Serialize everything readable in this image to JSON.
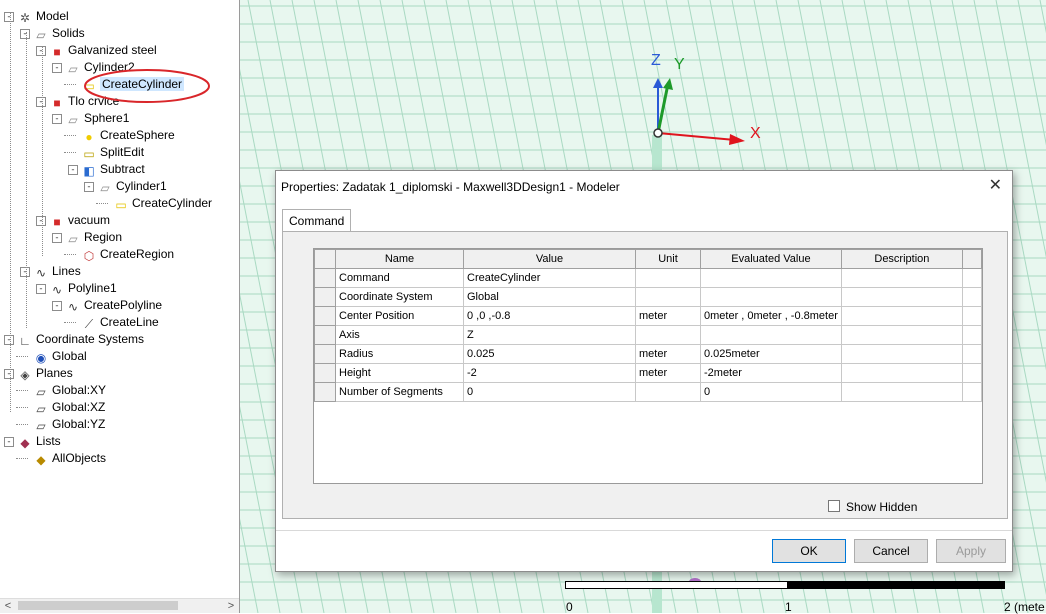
{
  "tree": {
    "nodes": [
      {
        "label": "Model",
        "icon": "model-icon",
        "level": 0,
        "expand": "-"
      },
      {
        "label": "Solids",
        "icon": "solids-folder-icon",
        "level": 1,
        "expand": "-"
      },
      {
        "label": "Galvanized steel",
        "icon": "material-icon",
        "level": 2,
        "expand": "-"
      },
      {
        "label": "Cylinder2",
        "icon": "solid-object-icon",
        "level": 3,
        "expand": "-"
      },
      {
        "label": "CreateCylinder",
        "icon": "cylinder-icon",
        "level": 4,
        "expand": "",
        "selected": true
      },
      {
        "label": "Tlo crvice",
        "icon": "material-icon",
        "level": 2,
        "expand": "-"
      },
      {
        "label": "Sphere1",
        "icon": "solid-object-icon",
        "level": 3,
        "expand": "-"
      },
      {
        "label": "CreateSphere",
        "icon": "sphere-icon",
        "level": 4,
        "expand": ""
      },
      {
        "label": "SplitEdit",
        "icon": "split-icon",
        "level": 4,
        "expand": ""
      },
      {
        "label": "Subtract",
        "icon": "subtract-icon",
        "level": 4,
        "expand": "-"
      },
      {
        "label": "Cylinder1",
        "icon": "solid-object-icon",
        "level": 5,
        "expand": "-"
      },
      {
        "label": "CreateCylinder",
        "icon": "cylinder-icon",
        "level": 6,
        "expand": ""
      },
      {
        "label": "vacuum",
        "icon": "material-icon",
        "level": 2,
        "expand": "-"
      },
      {
        "label": "Region",
        "icon": "solid-object-icon",
        "level": 3,
        "expand": "-"
      },
      {
        "label": "CreateRegion",
        "icon": "region-icon",
        "level": 4,
        "expand": ""
      },
      {
        "label": "Lines",
        "icon": "lines-icon",
        "level": 1,
        "expand": "-"
      },
      {
        "label": "Polyline1",
        "icon": "lines-icon",
        "level": 2,
        "expand": "-"
      },
      {
        "label": "CreatePolyline",
        "icon": "lines-icon",
        "level": 3,
        "expand": "-"
      },
      {
        "label": "CreateLine",
        "icon": "line-segment-icon",
        "level": 4,
        "expand": ""
      },
      {
        "label": "Coordinate Systems",
        "icon": "coordinate-system-icon",
        "level": 0,
        "expand": "-"
      },
      {
        "label": "Global",
        "icon": "global-cs-icon",
        "level": 1,
        "expand": ""
      },
      {
        "label": "Planes",
        "icon": "planes-icon",
        "level": 0,
        "expand": "-"
      },
      {
        "label": "Global:XY",
        "icon": "plane-icon",
        "level": 1,
        "expand": ""
      },
      {
        "label": "Global:XZ",
        "icon": "plane-icon",
        "level": 1,
        "expand": ""
      },
      {
        "label": "Global:YZ",
        "icon": "plane-icon",
        "level": 1,
        "expand": ""
      },
      {
        "label": "Lists",
        "icon": "lists-icon",
        "level": 0,
        "expand": "-"
      },
      {
        "label": "AllObjects",
        "icon": "all-objects-icon",
        "level": 1,
        "expand": ""
      }
    ],
    "scroll_left": "<",
    "scroll_right": ">"
  },
  "viewport": {
    "axis_z": "Z",
    "axis_y": "Y",
    "axis_x": "X",
    "scale_labels": [
      "0",
      "1",
      "2 (mete"
    ]
  },
  "dialog": {
    "title": "Properties: Zadatak 1_diplomski - Maxwell3DDesign1 - Modeler",
    "close": "✕",
    "tab": "Command",
    "columns": [
      "Name",
      "Value",
      "Unit",
      "Evaluated Value",
      "Description"
    ],
    "rows": [
      {
        "name": "Command",
        "value": "CreateCylinder",
        "unit": "",
        "evaluated": "",
        "description": ""
      },
      {
        "name": "Coordinate System",
        "value": "Global",
        "unit": "",
        "evaluated": "",
        "description": ""
      },
      {
        "name": "Center Position",
        "value": "0 ,0 ,-0.8",
        "unit": "meter",
        "evaluated": "0meter , 0meter , -0.8meter",
        "description": ""
      },
      {
        "name": "Axis",
        "value": "Z",
        "unit": "",
        "evaluated": "",
        "description": ""
      },
      {
        "name": "Radius",
        "value": "0.025",
        "unit": "meter",
        "evaluated": "0.025meter",
        "description": ""
      },
      {
        "name": "Height",
        "value": "-2",
        "unit": "meter",
        "evaluated": "-2meter",
        "description": ""
      },
      {
        "name": "Number of Segments",
        "value": "0",
        "unit": "",
        "evaluated": "0",
        "description": ""
      }
    ],
    "show_hidden": "Show Hidden",
    "ok": "OK",
    "cancel": "Cancel",
    "apply": "Apply"
  },
  "colors": {
    "viewport_bg": "#e8f7ef",
    "grid": "#a9d9c2",
    "highlight_ellipse": "#d9262a",
    "axis_x": "#e0141e",
    "axis_y": "#1e9a2a",
    "axis_z": "#2a5ad6"
  }
}
